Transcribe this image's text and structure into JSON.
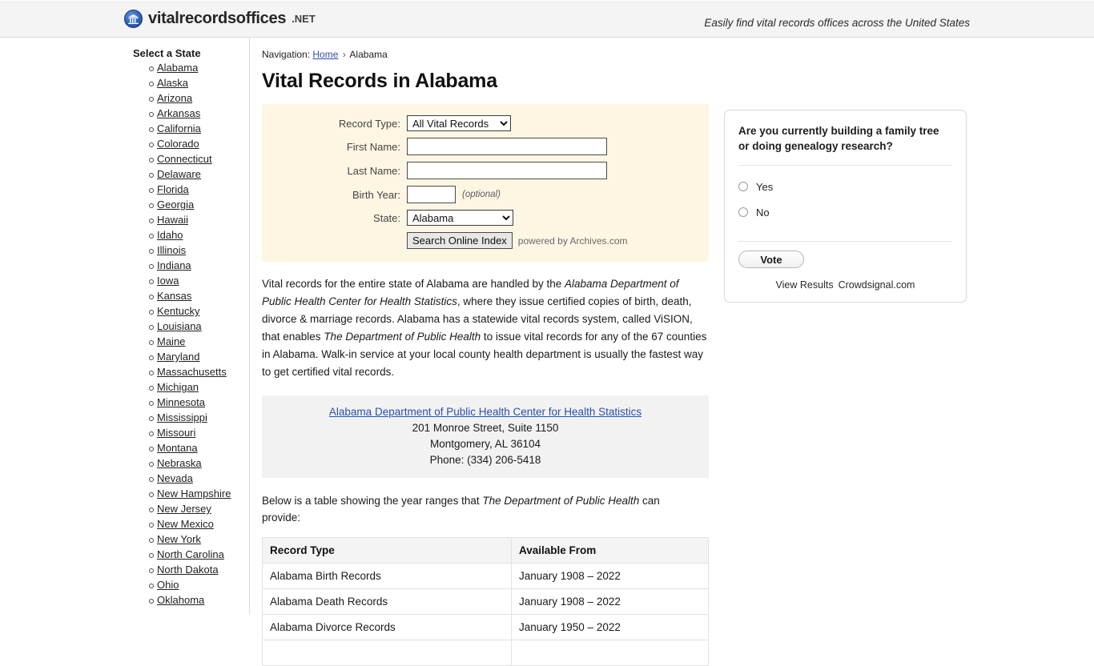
{
  "header": {
    "brand_name": "vitalrecordsoffices",
    "brand_tld": ".NET",
    "logo_icon": "bank-building-icon",
    "tagline": "Easily find vital records offices across the United States"
  },
  "sidebar": {
    "title": "Select a State",
    "states": [
      "Alabama",
      "Alaska",
      "Arizona",
      "Arkansas",
      "California",
      "Colorado",
      "Connecticut",
      "Delaware",
      "Florida",
      "Georgia",
      "Hawaii",
      "Idaho",
      "Illinois",
      "Indiana",
      "Iowa",
      "Kansas",
      "Kentucky",
      "Louisiana",
      "Maine",
      "Maryland",
      "Massachusetts",
      "Michigan",
      "Minnesota",
      "Mississippi",
      "Missouri",
      "Montana",
      "Nebraska",
      "Nevada",
      "New Hampshire",
      "New Jersey",
      "New Mexico",
      "New York",
      "North Carolina",
      "North Dakota",
      "Ohio",
      "Oklahoma"
    ]
  },
  "breadcrumb": {
    "prefix": "Navigation:",
    "home_label": "Home",
    "separator": "›",
    "current": "Alabama"
  },
  "page_title": "Vital Records in Alabama",
  "search_form": {
    "record_type_label": "Record Type:",
    "record_type_value": "All Vital Records",
    "record_type_options": [
      "All Vital Records"
    ],
    "first_name_label": "First Name:",
    "first_name_value": "",
    "last_name_label": "Last Name:",
    "last_name_value": "",
    "birth_year_label": "Birth Year:",
    "birth_year_value": "",
    "birth_year_note": "(optional)",
    "state_label": "State:",
    "state_value": "Alabama",
    "state_options": [
      "Alabama"
    ],
    "submit_label": "Search Online Index",
    "powered_by": "powered by Archives.com",
    "background_color": "#fdf6e3"
  },
  "body_paragraph": {
    "part1": "Vital records for the entire state of Alabama are handled by the ",
    "em1": "Alabama Department of Public Health Center for Health Statistics",
    "part2": ", where they issue certified copies of birth, death, divorce & marriage records. Alabama has a statewide vital records system, called ViSION, that enables ",
    "em2": "The Department of Public Health",
    "part3": " to issue vital records for any of the 67 counties in Alabama. Walk-in service at your local county health department is usually the fastest way to get certified vital records."
  },
  "address_box": {
    "org_link": "Alabama Department of Public Health Center for Health Statistics",
    "street": "201 Monroe Street, Suite 1150",
    "city_state_zip": "Montgomery, AL 36104",
    "phone": "Phone: (334) 206-5418"
  },
  "table_intro": {
    "part1": "Below is a table showing the year ranges that ",
    "em1": "The Department of Public Health",
    "part2": " can provide:"
  },
  "records_table": {
    "headers": [
      "Record Type",
      "Available From"
    ],
    "rows": [
      {
        "record_type": "Alabama Birth Records",
        "available_from": "January 1908 – 2022"
      },
      {
        "record_type": "Alabama Death Records",
        "available_from": "January 1908 – 2022"
      },
      {
        "record_type": "Alabama Divorce Records",
        "available_from": "January 1950 – 2022"
      },
      {
        "record_type": "",
        "available_from": ""
      }
    ]
  },
  "poll": {
    "question": "Are you currently building a family tree or doing genealogy research?",
    "options": [
      {
        "label": "Yes",
        "selected": false
      },
      {
        "label": "No",
        "selected": false
      }
    ],
    "vote_label": "Vote",
    "view_results_label": "View Results",
    "provider_label": "Crowdsignal.com"
  }
}
